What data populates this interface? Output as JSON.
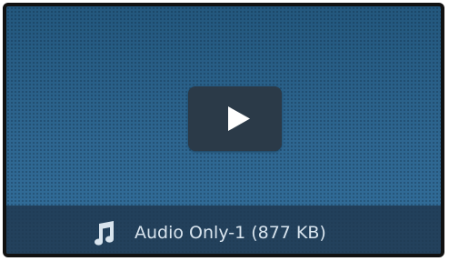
{
  "player": {
    "play_button_icon": "play-icon",
    "caption_icon": "music-note-icon",
    "caption": "Audio Only-1 (877 KB)"
  },
  "colors": {
    "background_blue": "#2e6690",
    "play_button": "#2b3a48",
    "caption_bar": "#20374e",
    "caption_text": "#d8e4ee"
  }
}
